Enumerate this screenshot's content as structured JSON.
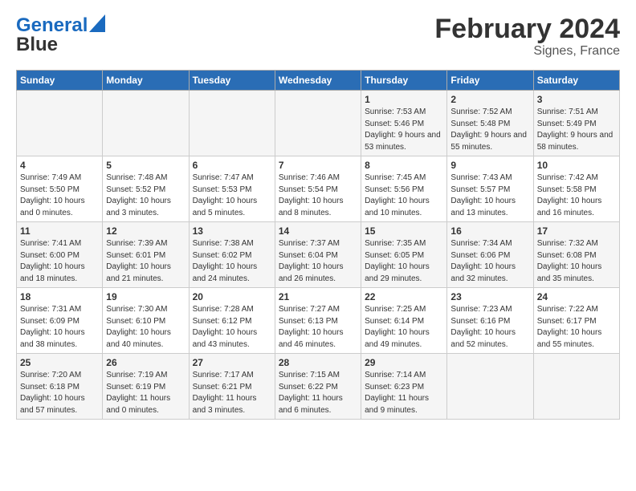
{
  "header": {
    "logo_line1": "General",
    "logo_line2": "Blue",
    "title": "February 2024",
    "subtitle": "Signes, France"
  },
  "days_of_week": [
    "Sunday",
    "Monday",
    "Tuesday",
    "Wednesday",
    "Thursday",
    "Friday",
    "Saturday"
  ],
  "weeks": [
    [
      {
        "day": "",
        "sunrise": "",
        "sunset": "",
        "daylight": ""
      },
      {
        "day": "",
        "sunrise": "",
        "sunset": "",
        "daylight": ""
      },
      {
        "day": "",
        "sunrise": "",
        "sunset": "",
        "daylight": ""
      },
      {
        "day": "",
        "sunrise": "",
        "sunset": "",
        "daylight": ""
      },
      {
        "day": "1",
        "sunrise": "7:53 AM",
        "sunset": "5:46 PM",
        "daylight": "9 hours and 53 minutes."
      },
      {
        "day": "2",
        "sunrise": "7:52 AM",
        "sunset": "5:48 PM",
        "daylight": "9 hours and 55 minutes."
      },
      {
        "day": "3",
        "sunrise": "7:51 AM",
        "sunset": "5:49 PM",
        "daylight": "9 hours and 58 minutes."
      }
    ],
    [
      {
        "day": "4",
        "sunrise": "7:49 AM",
        "sunset": "5:50 PM",
        "daylight": "10 hours and 0 minutes."
      },
      {
        "day": "5",
        "sunrise": "7:48 AM",
        "sunset": "5:52 PM",
        "daylight": "10 hours and 3 minutes."
      },
      {
        "day": "6",
        "sunrise": "7:47 AM",
        "sunset": "5:53 PM",
        "daylight": "10 hours and 5 minutes."
      },
      {
        "day": "7",
        "sunrise": "7:46 AM",
        "sunset": "5:54 PM",
        "daylight": "10 hours and 8 minutes."
      },
      {
        "day": "8",
        "sunrise": "7:45 AM",
        "sunset": "5:56 PM",
        "daylight": "10 hours and 10 minutes."
      },
      {
        "day": "9",
        "sunrise": "7:43 AM",
        "sunset": "5:57 PM",
        "daylight": "10 hours and 13 minutes."
      },
      {
        "day": "10",
        "sunrise": "7:42 AM",
        "sunset": "5:58 PM",
        "daylight": "10 hours and 16 minutes."
      }
    ],
    [
      {
        "day": "11",
        "sunrise": "7:41 AM",
        "sunset": "6:00 PM",
        "daylight": "10 hours and 18 minutes."
      },
      {
        "day": "12",
        "sunrise": "7:39 AM",
        "sunset": "6:01 PM",
        "daylight": "10 hours and 21 minutes."
      },
      {
        "day": "13",
        "sunrise": "7:38 AM",
        "sunset": "6:02 PM",
        "daylight": "10 hours and 24 minutes."
      },
      {
        "day": "14",
        "sunrise": "7:37 AM",
        "sunset": "6:04 PM",
        "daylight": "10 hours and 26 minutes."
      },
      {
        "day": "15",
        "sunrise": "7:35 AM",
        "sunset": "6:05 PM",
        "daylight": "10 hours and 29 minutes."
      },
      {
        "day": "16",
        "sunrise": "7:34 AM",
        "sunset": "6:06 PM",
        "daylight": "10 hours and 32 minutes."
      },
      {
        "day": "17",
        "sunrise": "7:32 AM",
        "sunset": "6:08 PM",
        "daylight": "10 hours and 35 minutes."
      }
    ],
    [
      {
        "day": "18",
        "sunrise": "7:31 AM",
        "sunset": "6:09 PM",
        "daylight": "10 hours and 38 minutes."
      },
      {
        "day": "19",
        "sunrise": "7:30 AM",
        "sunset": "6:10 PM",
        "daylight": "10 hours and 40 minutes."
      },
      {
        "day": "20",
        "sunrise": "7:28 AM",
        "sunset": "6:12 PM",
        "daylight": "10 hours and 43 minutes."
      },
      {
        "day": "21",
        "sunrise": "7:27 AM",
        "sunset": "6:13 PM",
        "daylight": "10 hours and 46 minutes."
      },
      {
        "day": "22",
        "sunrise": "7:25 AM",
        "sunset": "6:14 PM",
        "daylight": "10 hours and 49 minutes."
      },
      {
        "day": "23",
        "sunrise": "7:23 AM",
        "sunset": "6:16 PM",
        "daylight": "10 hours and 52 minutes."
      },
      {
        "day": "24",
        "sunrise": "7:22 AM",
        "sunset": "6:17 PM",
        "daylight": "10 hours and 55 minutes."
      }
    ],
    [
      {
        "day": "25",
        "sunrise": "7:20 AM",
        "sunset": "6:18 PM",
        "daylight": "10 hours and 57 minutes."
      },
      {
        "day": "26",
        "sunrise": "7:19 AM",
        "sunset": "6:19 PM",
        "daylight": "11 hours and 0 minutes."
      },
      {
        "day": "27",
        "sunrise": "7:17 AM",
        "sunset": "6:21 PM",
        "daylight": "11 hours and 3 minutes."
      },
      {
        "day": "28",
        "sunrise": "7:15 AM",
        "sunset": "6:22 PM",
        "daylight": "11 hours and 6 minutes."
      },
      {
        "day": "29",
        "sunrise": "7:14 AM",
        "sunset": "6:23 PM",
        "daylight": "11 hours and 9 minutes."
      },
      {
        "day": "",
        "sunrise": "",
        "sunset": "",
        "daylight": ""
      },
      {
        "day": "",
        "sunrise": "",
        "sunset": "",
        "daylight": ""
      }
    ]
  ]
}
